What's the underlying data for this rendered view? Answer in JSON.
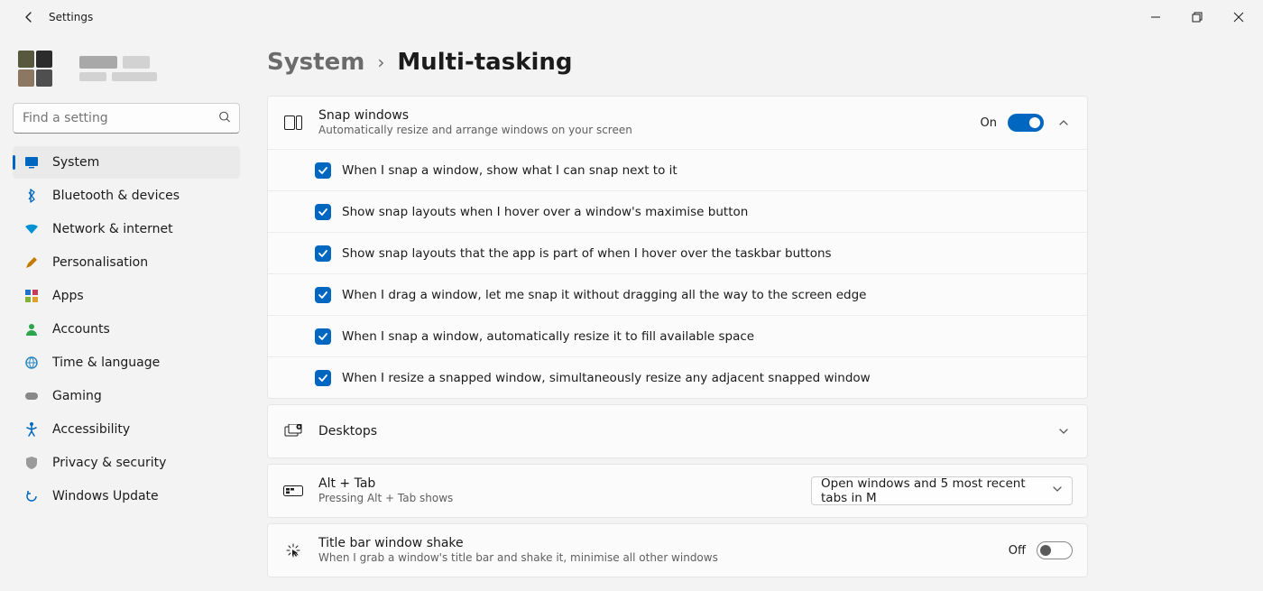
{
  "app_title": "Settings",
  "search_placeholder": "Find a setting",
  "nav": {
    "items": [
      {
        "label": "System"
      },
      {
        "label": "Bluetooth & devices"
      },
      {
        "label": "Network & internet"
      },
      {
        "label": "Personalisation"
      },
      {
        "label": "Apps"
      },
      {
        "label": "Accounts"
      },
      {
        "label": "Time & language"
      },
      {
        "label": "Gaming"
      },
      {
        "label": "Accessibility"
      },
      {
        "label": "Privacy & security"
      },
      {
        "label": "Windows Update"
      }
    ]
  },
  "breadcrumb": {
    "parent": "System",
    "current": "Multi-tasking"
  },
  "snap": {
    "title": "Snap windows",
    "subtitle": "Automatically resize and arrange windows on your screen",
    "state_label": "On",
    "state": true,
    "options": [
      {
        "label": "When I snap a window, show what I can snap next to it",
        "checked": true
      },
      {
        "label": "Show snap layouts when I hover over a window's maximise button",
        "checked": true
      },
      {
        "label": "Show snap layouts that the app is part of when I hover over the taskbar buttons",
        "checked": true
      },
      {
        "label": "When I drag a window, let me snap it without dragging all the way to the screen edge",
        "checked": true
      },
      {
        "label": "When I snap a window, automatically resize it to fill available space",
        "checked": true
      },
      {
        "label": "When I resize a snapped window, simultaneously resize any adjacent snapped window",
        "checked": true
      }
    ]
  },
  "desktops": {
    "title": "Desktops"
  },
  "alttab": {
    "title": "Alt + Tab",
    "subtitle": "Pressing Alt + Tab shows",
    "selected": "Open windows and 5 most recent tabs in M"
  },
  "shake": {
    "title": "Title bar window shake",
    "subtitle": "When I grab a window's title bar and shake it, minimise all other windows",
    "state_label": "Off",
    "state": false
  },
  "colors": {
    "accent": "#0067c0"
  }
}
